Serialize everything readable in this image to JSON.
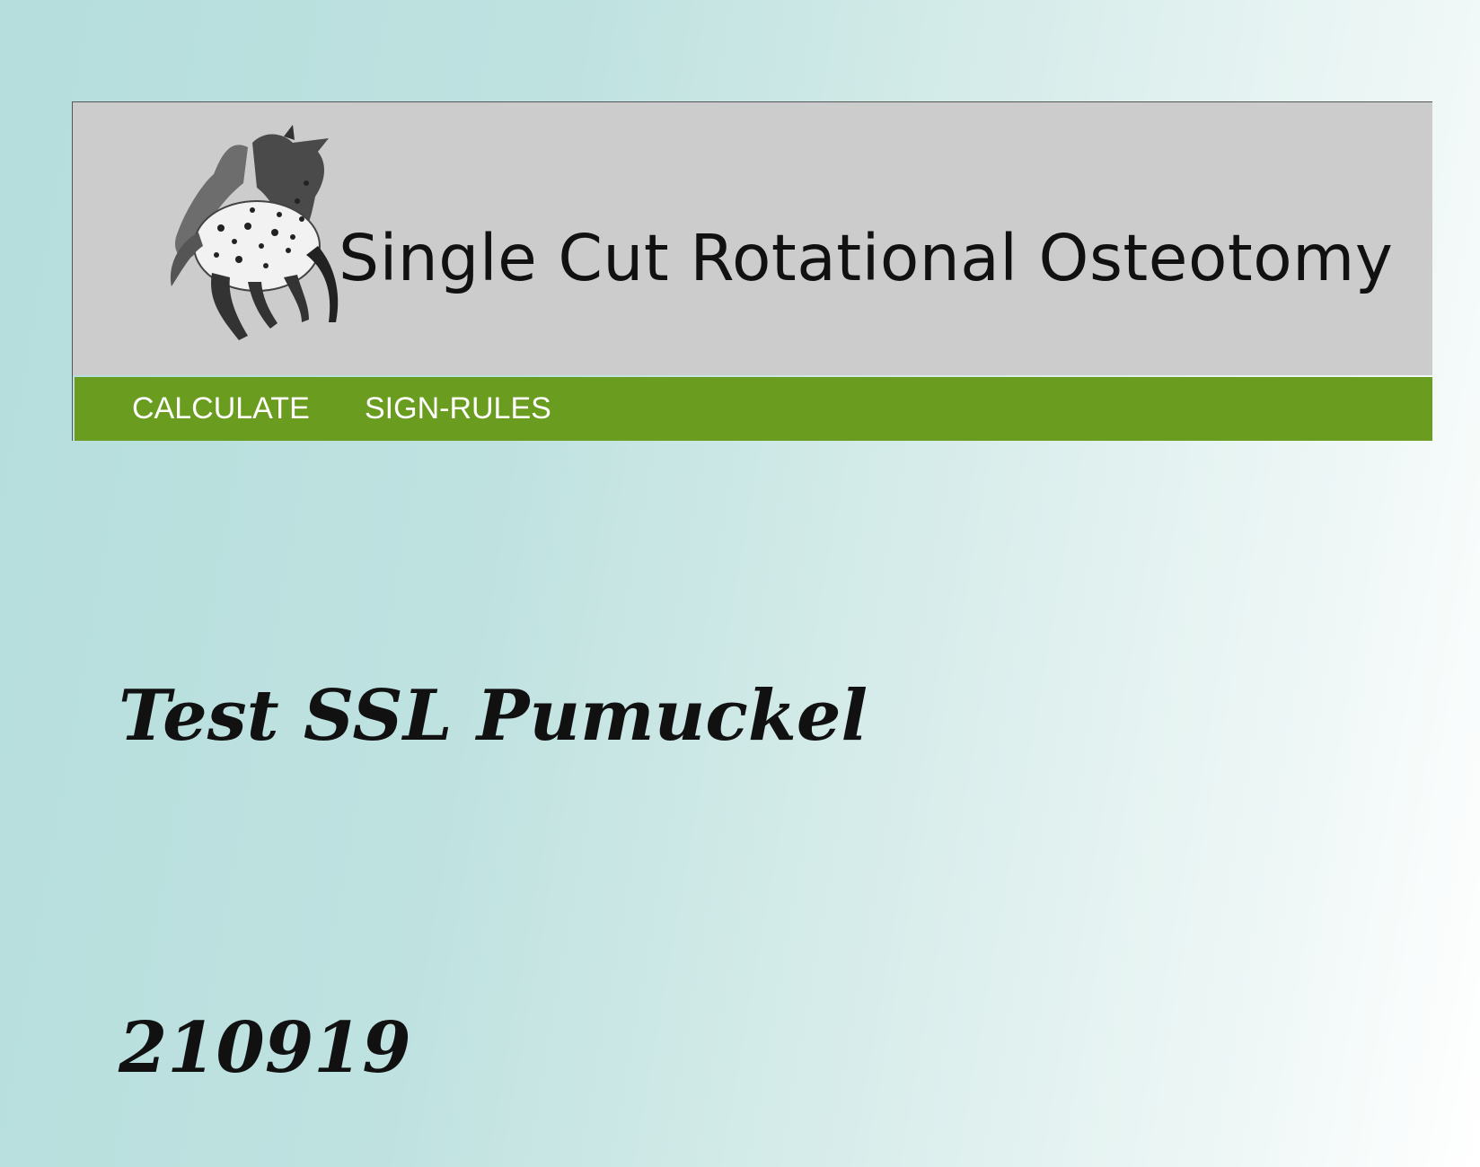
{
  "header": {
    "title": "Single Cut Rotational Osteotomy",
    "logo_icon": "horse-logo-icon"
  },
  "nav": {
    "items": [
      {
        "label": "CALCULATE"
      },
      {
        "label": "SIGN-RULES"
      }
    ]
  },
  "content": {
    "heading": "Test SSL Pumuckel",
    "date": "210919"
  },
  "colors": {
    "banner": "#cccccc",
    "navbar": "#6a9d1f",
    "nav_text": "#ffffff"
  }
}
